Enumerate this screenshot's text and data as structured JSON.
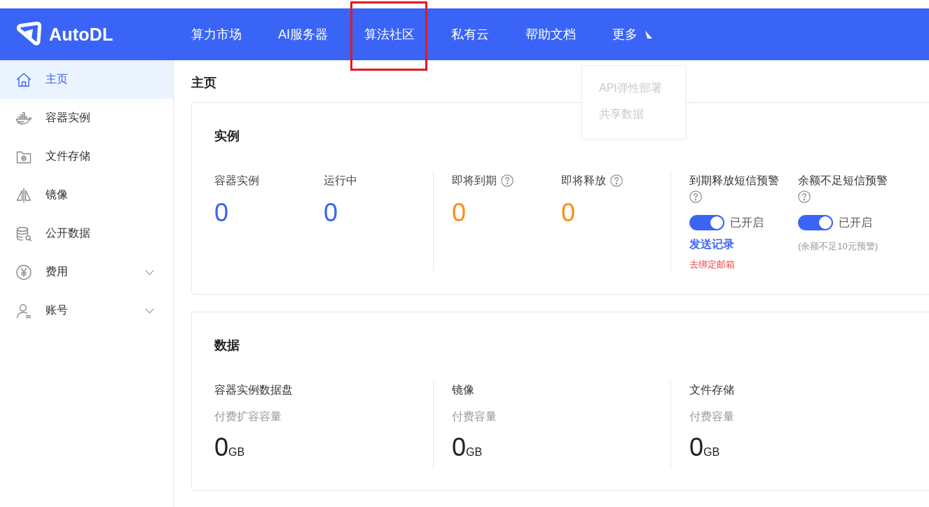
{
  "header": {
    "brand": "AutoDL",
    "nav": [
      {
        "label": "算力市场",
        "kind": "link",
        "highlighted": false
      },
      {
        "label": "AI服务器",
        "kind": "link",
        "highlighted": false
      },
      {
        "label": "算法社区",
        "kind": "link",
        "highlighted": true
      },
      {
        "label": "私有云",
        "kind": "link",
        "highlighted": false
      },
      {
        "label": "帮助文档",
        "kind": "link",
        "highlighted": false
      },
      {
        "label": "更多",
        "kind": "menu",
        "highlighted": false,
        "expanded": true,
        "menu": [
          "API弹性部署",
          "共享数据"
        ]
      }
    ]
  },
  "sidebar": {
    "items": [
      {
        "label": "主页",
        "kind": "link",
        "selected": true
      },
      {
        "label": "容器实例",
        "kind": "link",
        "selected": false
      },
      {
        "label": "文件存储",
        "kind": "link",
        "selected": false
      },
      {
        "label": "镜像",
        "kind": "link",
        "selected": false
      },
      {
        "label": "公开数据",
        "kind": "link",
        "selected": false
      },
      {
        "label": "费用",
        "kind": "group",
        "selected": false,
        "expanded": false
      },
      {
        "label": "账号",
        "kind": "group",
        "selected": false,
        "expanded": false
      }
    ]
  },
  "page": {
    "title": "主页"
  },
  "instances": {
    "title": "实例",
    "groups": [
      {
        "stats": [
          {
            "label": "容器实例",
            "value": "0",
            "help": false,
            "color": "#3a64f6"
          },
          {
            "label": "运行中",
            "value": "0",
            "help": false,
            "color": "#3a64f6"
          }
        ]
      },
      {
        "stats": [
          {
            "label": "即将到期",
            "value": "0",
            "help": true,
            "color": "#ff8c1a"
          },
          {
            "label": "即将释放",
            "value": "0",
            "help": true,
            "color": "#ff8c1a"
          }
        ]
      }
    ],
    "alerts": [
      {
        "label": "到期释放短信预警",
        "help": true,
        "on": true,
        "status": "已开启",
        "extras": [
          {
            "kind": "link",
            "text": "发送记录"
          },
          {
            "kind": "warning",
            "text": "去绑定邮箱"
          }
        ]
      },
      {
        "label": "余额不足短信预警",
        "help": true,
        "on": true,
        "status": "已开启",
        "extras": [
          {
            "kind": "note",
            "text": "(余额不足10元预警)"
          }
        ]
      }
    ]
  },
  "data": {
    "title": "数据",
    "columns": [
      {
        "label": "容器实例数据盘",
        "sublabel": "付费扩容容量",
        "value": "0",
        "unit": "GB"
      },
      {
        "label": "镜像",
        "sublabel": "付费容量",
        "value": "0",
        "unit": "GB"
      },
      {
        "label": "文件存储",
        "sublabel": "付费容量",
        "value": "0",
        "unit": "GB"
      }
    ]
  }
}
